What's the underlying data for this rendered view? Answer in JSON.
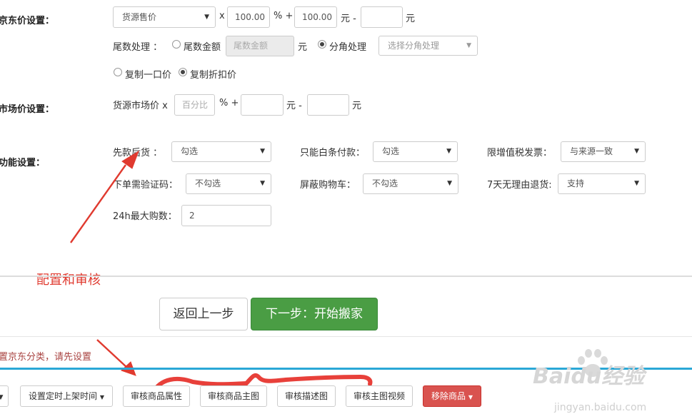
{
  "jd_price": {
    "label": "京东价设置：",
    "source_select": "货源售价",
    "x_sign": "x",
    "percent_value": "100.00",
    "percent_sign": "% +",
    "add_value": "100.00",
    "yuan_minus": "元 -",
    "minus_value": "",
    "yuan": "元",
    "tail_label": "尾数处理 ：",
    "tail_amount_label": "尾数金额",
    "tail_amount_placeholder": "尾数金额",
    "tail_yuan": "元",
    "fen_label": "分角处理",
    "fen_select_placeholder": "选择分角处理",
    "copy_one_price": "复制一口价",
    "copy_discount_price": "复制折扣价"
  },
  "market_price": {
    "label": "市场价设置：",
    "prefix": "货源市场价 x",
    "percent_placeholder": "百分比",
    "percent_sign": "% +",
    "add_value": "",
    "yuan_minus": "元 -",
    "minus_value": "",
    "yuan": "元"
  },
  "features": {
    "label": "功能设置：",
    "pay_later_label": "先款后货 ：",
    "pay_later_value": "勾选",
    "baitiao_label": "只能白条付款：",
    "baitiao_value": "勾选",
    "vat_label": "限增值税发票：",
    "vat_value": "与来源一致",
    "id_verify_label": "下单需验证码：",
    "id_verify_value": "不勾选",
    "hide_cart_label": "屏蔽购物车：",
    "hide_cart_value": "不勾选",
    "return_label": "7天无理由退货:",
    "return_value": "支持",
    "max_buy_label": "24h最大购数：",
    "max_buy_value": "2"
  },
  "annotation": {
    "text": "配置和审核",
    "color": "#e03a2f"
  },
  "actions": {
    "back_label": "返回上一步",
    "next_label": "下一步：开始搬家"
  },
  "notice": {
    "text": "置京东分类，请先设置"
  },
  "toolbar": {
    "schedule_label": "设置定时上架时间",
    "review_attr_label": "审核商品属性",
    "review_main_img_label": "审核商品主图",
    "review_desc_img_label": "审核描述图",
    "review_video_label": "审核主图视频",
    "remove_label": "移除商品"
  },
  "watermark": {
    "brand": "Baidu经验",
    "url": "jingyan.baidu.com"
  },
  "colors": {
    "accent_line": "#2aa7d6",
    "next_button": "#4a9d44",
    "danger_button": "#d9534f",
    "annotation": "#e03a2f"
  }
}
